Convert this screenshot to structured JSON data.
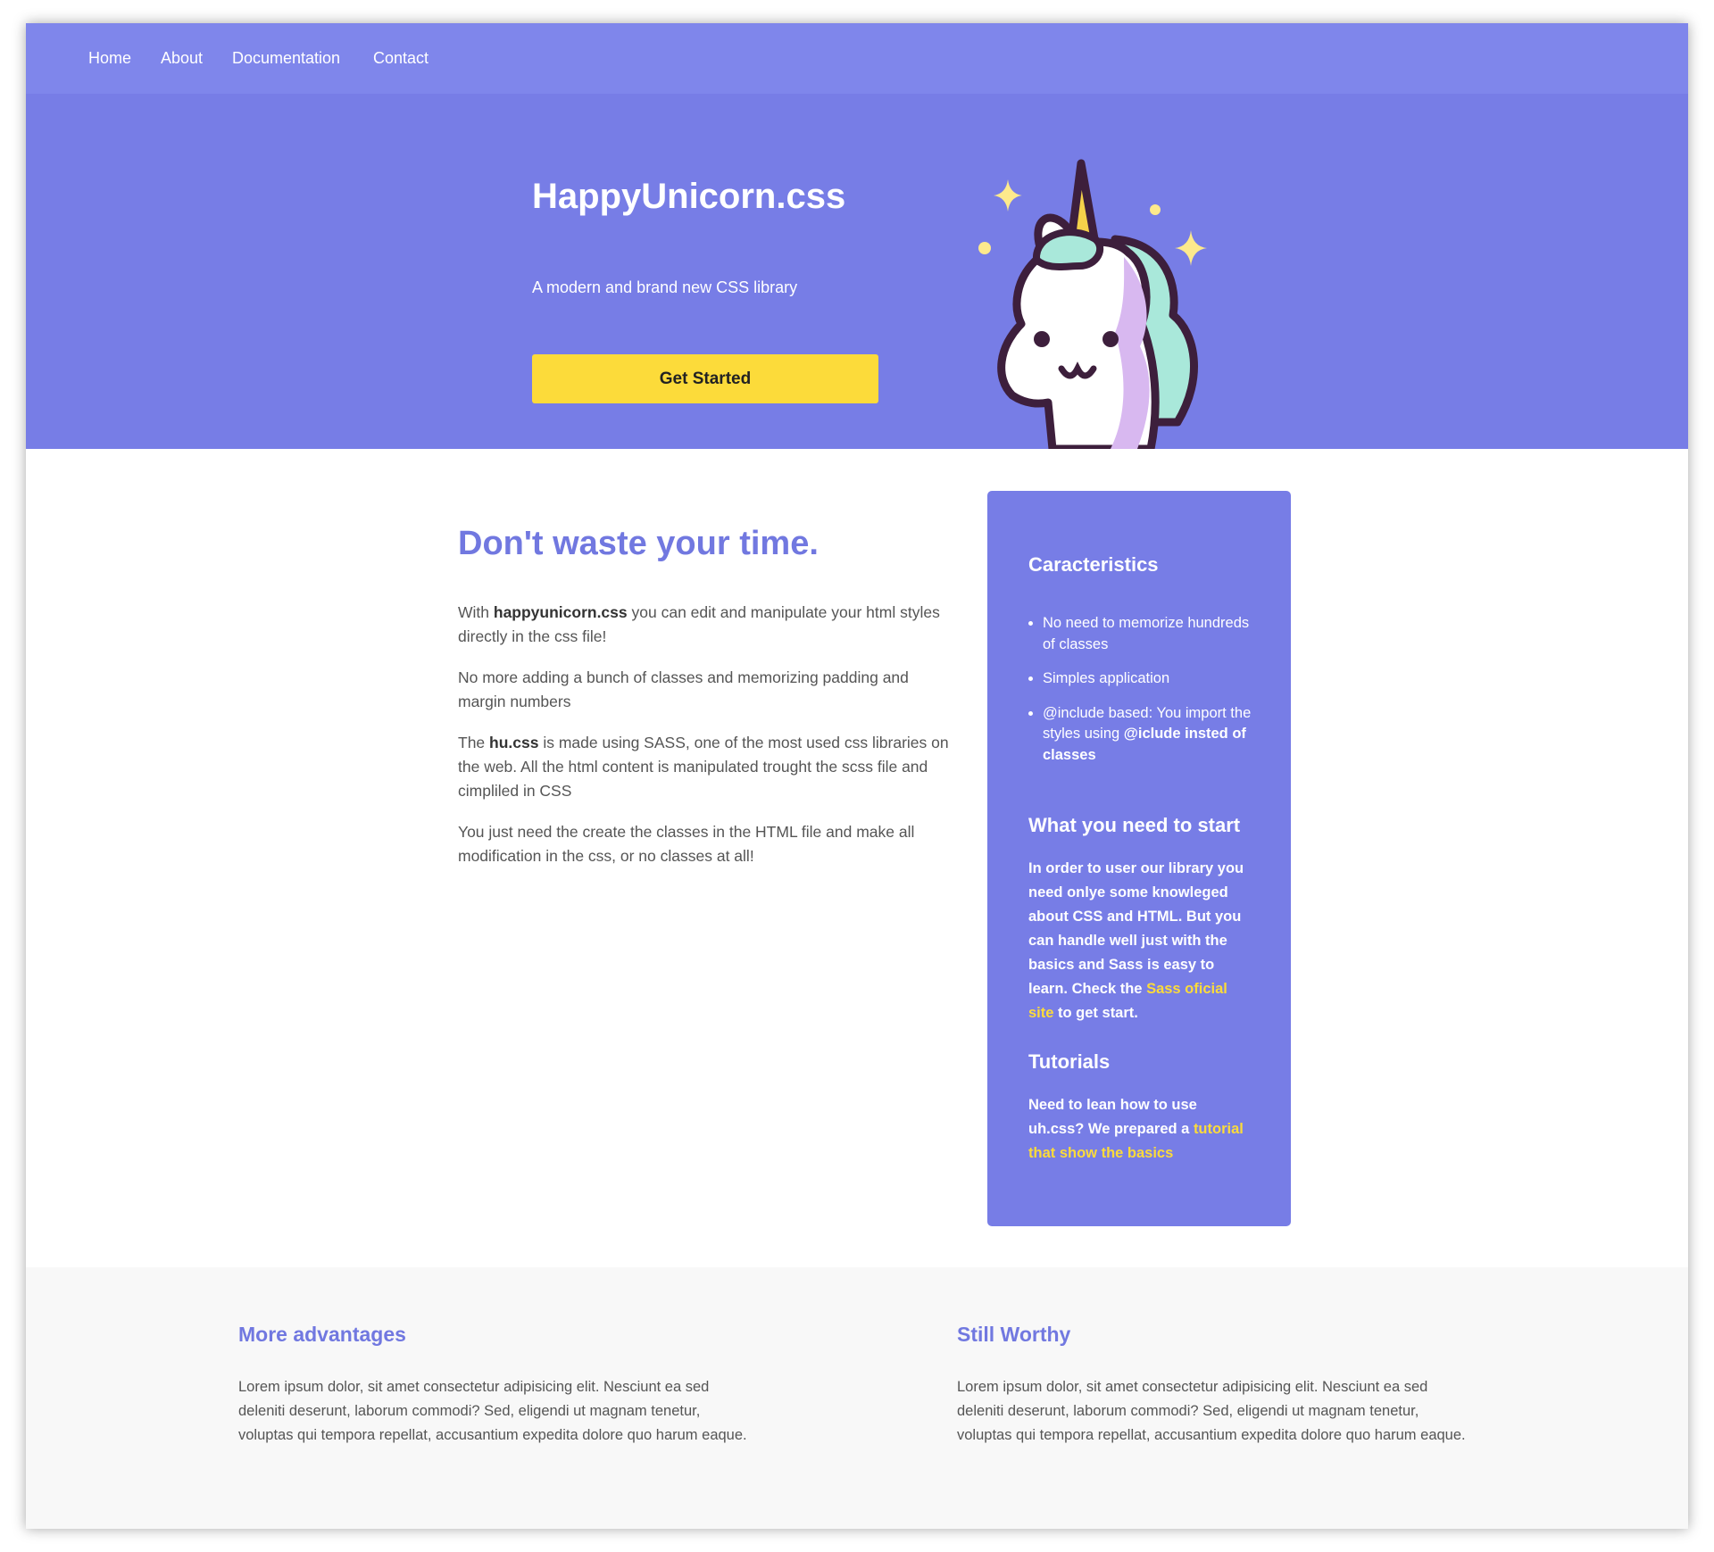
{
  "nav": {
    "items": [
      {
        "label": "Home"
      },
      {
        "label": "About"
      },
      {
        "label": "Documentation"
      },
      {
        "label": "Contact"
      }
    ]
  },
  "hero": {
    "title": "HappyUnicorn.css",
    "subtitle": "A modern and brand new CSS library",
    "button_label": "Get Started",
    "image": "unicorn-illustration"
  },
  "main": {
    "title": "Don't waste your time.",
    "p1_pre": "With ",
    "p1_bold": "happyunicorn.css",
    "p1_post": " you can edit and manipulate your html styles directly in the css file!",
    "p2": "No more adding a bunch of classes and memorizing padding and margin numbers",
    "p3_pre": "The ",
    "p3_bold": "hu.css",
    "p3_post": " is made using SASS, one of the most used css libraries on the web. All the html content is manipulated trought the scss file and cimpliled in CSS",
    "p4": "You just need the create the classes in the HTML file and make all modification in the css, or no classes at all!"
  },
  "sidebar": {
    "h1": "Caracteristics",
    "li1": "No need to memorize hundreds of classes",
    "li2": "Simples application",
    "li3_pre": "@include based: You import the styles using ",
    "li3_bold": "@iclude insted of classes",
    "h2": "What you need to start",
    "p1_pre": "In order to user our library you need onlye some knowleged about CSS and HTML. But you can handle well just with the basics and Sass is easy to learn. Check the ",
    "p1_link": "Sass oficial site",
    "p1_post": " to get start.",
    "h3": "Tutorials",
    "p2_pre": "Need to lean how to use uh.css? We prepared a ",
    "p2_link": "tutorial that show the basics"
  },
  "footer": {
    "col1_title": "More advantages",
    "col1_text": "Lorem ipsum dolor, sit amet consectetur adipisicing elit. Nesciunt ea sed deleniti deserunt, laborum commodi? Sed, eligendi ut magnam tenetur, voluptas qui tempora repellat, accusantium expedita dolore quo harum eaque.",
    "col2_title": "Still Worthy",
    "col2_text": "Lorem ipsum dolor, sit amet consectetur adipisicing elit. Nesciunt ea sed deleniti deserunt, laborum commodi? Sed, eligendi ut magnam tenetur, voluptas qui tempora repellat, accusantium expedita dolore quo harum eaque."
  },
  "colors": {
    "nav_bg": "#7f86eb",
    "hero_bg": "#777de6",
    "accent": "#7178e0",
    "button_bg": "#fcdb3a",
    "link": "#fcdb3a",
    "footer_bg": "#f8f8f8"
  }
}
